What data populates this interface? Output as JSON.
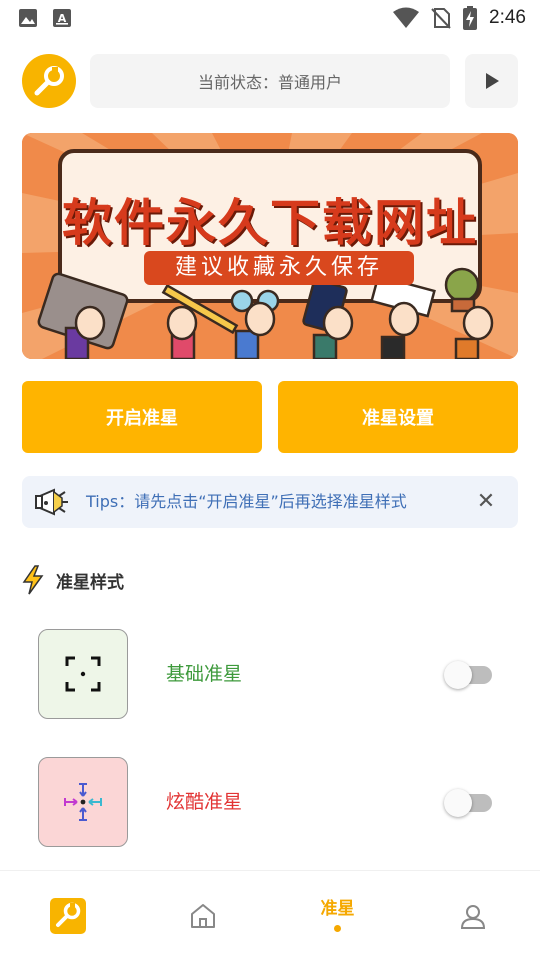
{
  "status_bar": {
    "time": "2:46",
    "icons": [
      "image-icon",
      "text-a-icon",
      "wifi-icon",
      "no-sim-icon",
      "battery-charging-icon"
    ]
  },
  "header": {
    "status_text": "当前状态：普通用户",
    "logo_icon": "wrench-icon",
    "play_icon": "play-icon"
  },
  "banner": {
    "title": "软件永久下载网址",
    "subtitle": "建议收藏永久保存"
  },
  "actions": {
    "enable_label": "开启准星",
    "settings_label": "准星设置"
  },
  "tips": {
    "text": "Tips：请先点击“开启准星”后再选择准星样式",
    "close_label": "✕"
  },
  "section": {
    "title": "准星样式",
    "icon": "lightning-icon"
  },
  "styles": [
    {
      "name": "基础准星",
      "enabled": false,
      "color": "#3e9a3c"
    },
    {
      "name": "炫酷准星",
      "enabled": false,
      "color": "#e23434"
    }
  ],
  "bottom_nav": {
    "items": [
      {
        "icon": "wrench-app-icon",
        "label": ""
      },
      {
        "icon": "home-icon",
        "label": ""
      },
      {
        "icon": "",
        "label": "准星",
        "active": true
      },
      {
        "icon": "user-icon",
        "label": ""
      }
    ]
  },
  "colors": {
    "accent": "#ffb400",
    "tips_text": "#3f6fb6",
    "active_nav": "#f5a800"
  }
}
